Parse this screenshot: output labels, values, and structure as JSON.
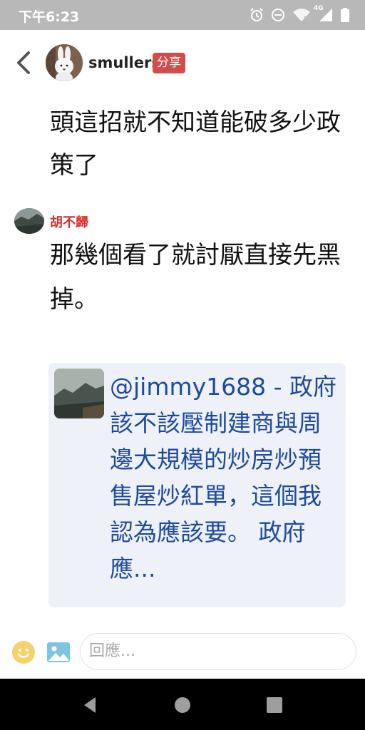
{
  "status_bar": {
    "time": "下午6:23",
    "network": "4G"
  },
  "header": {
    "username": "smullers",
    "share_label": "分享"
  },
  "post": {
    "text": "頭這招就不知道能破多少政策了"
  },
  "comment": {
    "author": "胡不歸",
    "text": "那幾個看了就討厭直接先黑掉。",
    "quote": "@jimmy1688 - 政府該不該壓制建商與周邊大規模的炒房炒預售屋炒紅單，這個我認為應該要。 政府應..."
  },
  "reply": {
    "placeholder": "回應..."
  },
  "colors": {
    "accent_red": "#d32f2f",
    "share_bg": "#d34b4b",
    "quote_text": "#1f4a9c",
    "quote_bg": "#eef1f8"
  }
}
